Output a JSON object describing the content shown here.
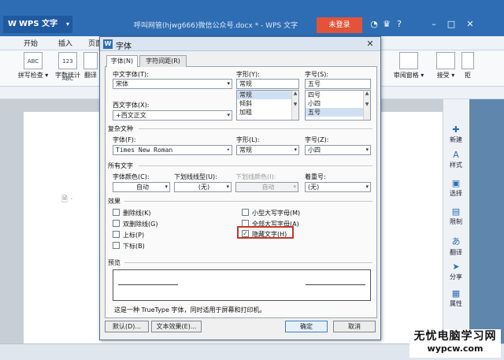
{
  "app": {
    "name": "WPS 文字",
    "doc_title": "呼叫网管(hjwg666)微信公众号.docx * - WPS 文字",
    "login": "未登录",
    "menu_tabs": [
      "开始",
      "插入",
      "页面"
    ],
    "ribbon_left": [
      {
        "icon_text": "ABC",
        "label": "拼写检查 ▾"
      },
      {
        "icon_text": "123 ABC",
        "label": "字数统计"
      },
      {
        "icon_text": "",
        "label": "翻译"
      }
    ],
    "ribbon_right": [
      {
        "label": "审阅窗格 ▾"
      },
      {
        "label": "接受 ▾"
      },
      {
        "label": "拒"
      }
    ],
    "right_pane": [
      {
        "icon": "plus-doc-icon",
        "label": "新建"
      },
      {
        "icon": "style-icon",
        "label": "样式"
      },
      {
        "icon": "select-icon",
        "label": "选择"
      },
      {
        "icon": "restrict-icon",
        "label": "限制"
      },
      {
        "icon": "translate-icon",
        "label": "翻译"
      },
      {
        "icon": "share-icon",
        "label": "分享"
      },
      {
        "icon": "property-icon",
        "label": "属性"
      }
    ],
    "watermark_line1": "无忧电脑学习网",
    "watermark_line2": "wypcw.com"
  },
  "dialog": {
    "title": "字体",
    "tabs": [
      {
        "label": "字体(N)",
        "active": true
      },
      {
        "label": "字符间距(R)",
        "active": false
      }
    ],
    "chinese_font": {
      "label": "中文字体(T):",
      "value": "宋体"
    },
    "style": {
      "label": "字形(Y):",
      "value": "常规",
      "options": [
        "常规",
        "倾斜",
        "加粗"
      ],
      "selected": 0
    },
    "size": {
      "label": "字号(S):",
      "value": "五号",
      "options": [
        "四号",
        "小四",
        "五号"
      ],
      "selected": 2
    },
    "western_font": {
      "label": "西文字体(X):",
      "value": "+西文正文"
    },
    "complex": {
      "heading": "复杂文种",
      "font": {
        "label": "字体(F):",
        "value": "Times New Roman"
      },
      "style": {
        "label": "字形(L):",
        "value": "常规"
      },
      "size": {
        "label": "字号(Z):",
        "value": "小四"
      }
    },
    "all_text": {
      "heading": "所有文字",
      "color": {
        "label": "字体颜色(C):",
        "value": "自动"
      },
      "underline": {
        "label": "下划线线型(U):",
        "value": "(无)"
      },
      "underline_color": {
        "label": "下划线颜色(I):",
        "value": "自动"
      },
      "emphasis": {
        "label": "着重号:",
        "value": "(无)"
      }
    },
    "effects": {
      "heading": "效果",
      "left": [
        {
          "label": "删除线(K)",
          "checked": false
        },
        {
          "label": "双删除线(G)",
          "checked": false
        },
        {
          "label": "上标(P)",
          "checked": false
        },
        {
          "label": "下标(B)",
          "checked": false
        }
      ],
      "right": [
        {
          "label": "小型大写字母(M)",
          "checked": false
        },
        {
          "label": "全部大写字母(A)",
          "checked": false
        },
        {
          "label": "隐藏文字(H)",
          "checked": true
        }
      ]
    },
    "preview": {
      "heading": "预览",
      "note": "这是一种 TrueType 字体，同时适用于屏幕和打印机。"
    },
    "buttons": {
      "default": "默认(D)...",
      "text_effects": "文本效果(E)...",
      "ok": "确定",
      "cancel": "取消"
    }
  }
}
